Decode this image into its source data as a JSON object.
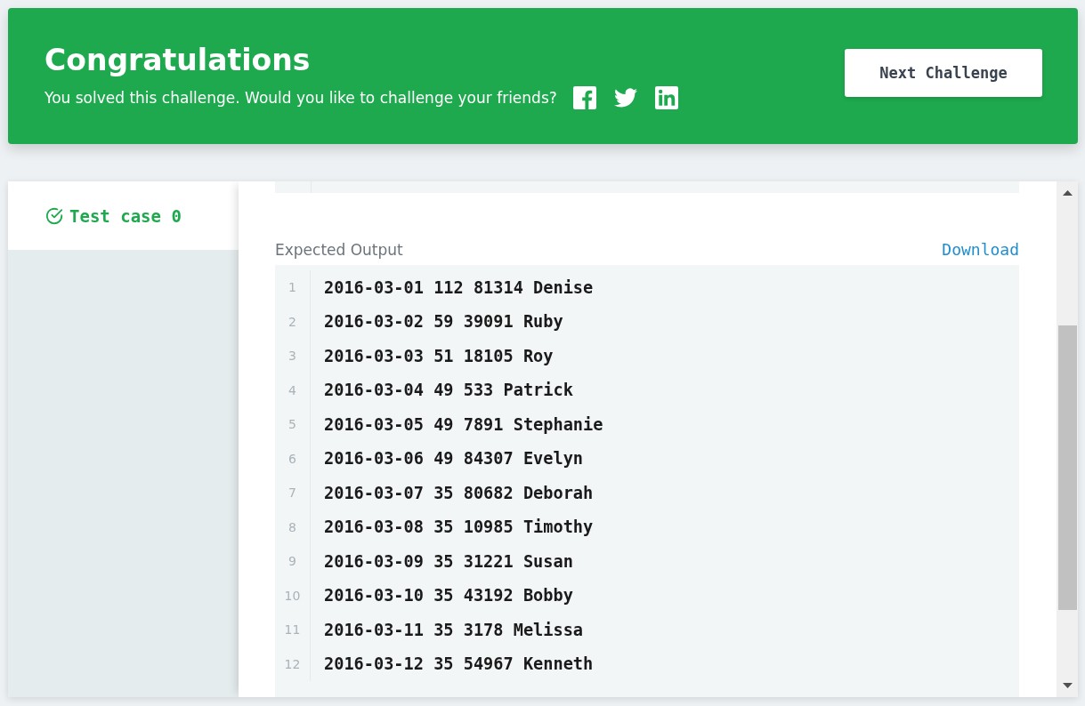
{
  "banner": {
    "title": "Congratulations",
    "message": "You solved this challenge. Would you like to challenge your friends?",
    "button": "Next Challenge"
  },
  "test_cases": [
    {
      "label": "Test case 0",
      "selected": true,
      "passed": true
    }
  ],
  "expected_output": {
    "label": "Expected Output",
    "download": "Download",
    "lines": [
      {
        "number": "1",
        "text": "2016-03-01 112 81314 Denise"
      },
      {
        "number": "2",
        "text": "2016-03-02 59 39091 Ruby"
      },
      {
        "number": "3",
        "text": "2016-03-03 51 18105 Roy"
      },
      {
        "number": "4",
        "text": "2016-03-04 49 533 Patrick"
      },
      {
        "number": "5",
        "text": "2016-03-05 49 7891 Stephanie"
      },
      {
        "number": "6",
        "text": "2016-03-06 49 84307 Evelyn"
      },
      {
        "number": "7",
        "text": "2016-03-07 35 80682 Deborah"
      },
      {
        "number": "8",
        "text": "2016-03-08 35 10985 Timothy"
      },
      {
        "number": "9",
        "text": "2016-03-09 35 31221 Susan"
      },
      {
        "number": "10",
        "text": "2016-03-10 35 43192 Bobby"
      },
      {
        "number": "11",
        "text": "2016-03-11 35 3178 Melissa"
      },
      {
        "number": "12",
        "text": "2016-03-12 35 54967 Kenneth"
      }
    ]
  }
}
